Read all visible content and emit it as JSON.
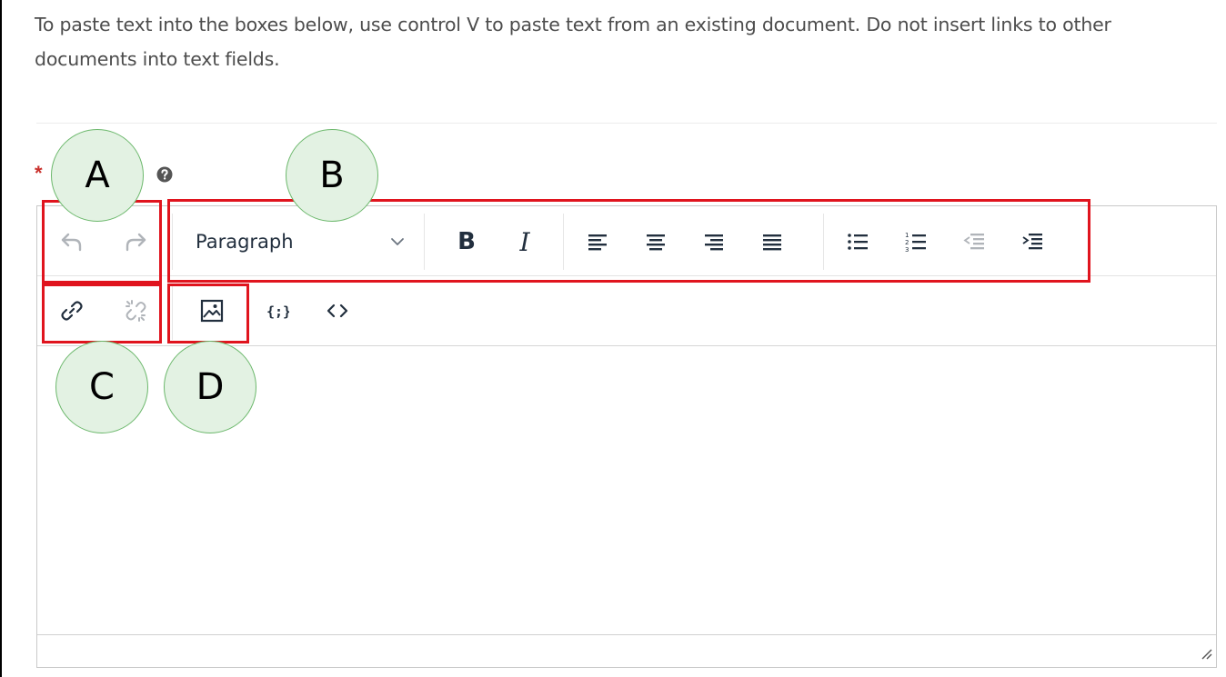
{
  "instructions": "To paste text into the boxes below, use control V to paste text from an existing document. Do not insert links to other documents into text fields.",
  "field": {
    "required_marker": "*",
    "help_icon": "question-circle-icon"
  },
  "editor": {
    "toolbar": {
      "undo": "undo-icon",
      "redo": "redo-icon",
      "block_format": "Paragraph",
      "bold_label": "B",
      "italic_label": "I",
      "align_left": "align-left-icon",
      "align_center": "align-center-icon",
      "align_right": "align-right-icon",
      "align_justify": "align-justify-icon",
      "bullet_list": "bullet-list-icon",
      "numbered_list": "numbered-list-icon",
      "outdent": "outdent-icon",
      "indent": "indent-icon",
      "link": "link-icon",
      "unlink": "unlink-icon",
      "image": "image-icon",
      "code_sample": "code-sample-icon",
      "source_code": "source-code-icon"
    },
    "content": ""
  },
  "annotations": {
    "a": "A",
    "b": "B",
    "c": "C",
    "d": "D"
  },
  "colors": {
    "callout_border": "#e0141e",
    "callout_fill": "#e3f2e3",
    "required": "#c9302c",
    "icon": "#222f3e",
    "icon_disabled": "#b0b4b9"
  }
}
